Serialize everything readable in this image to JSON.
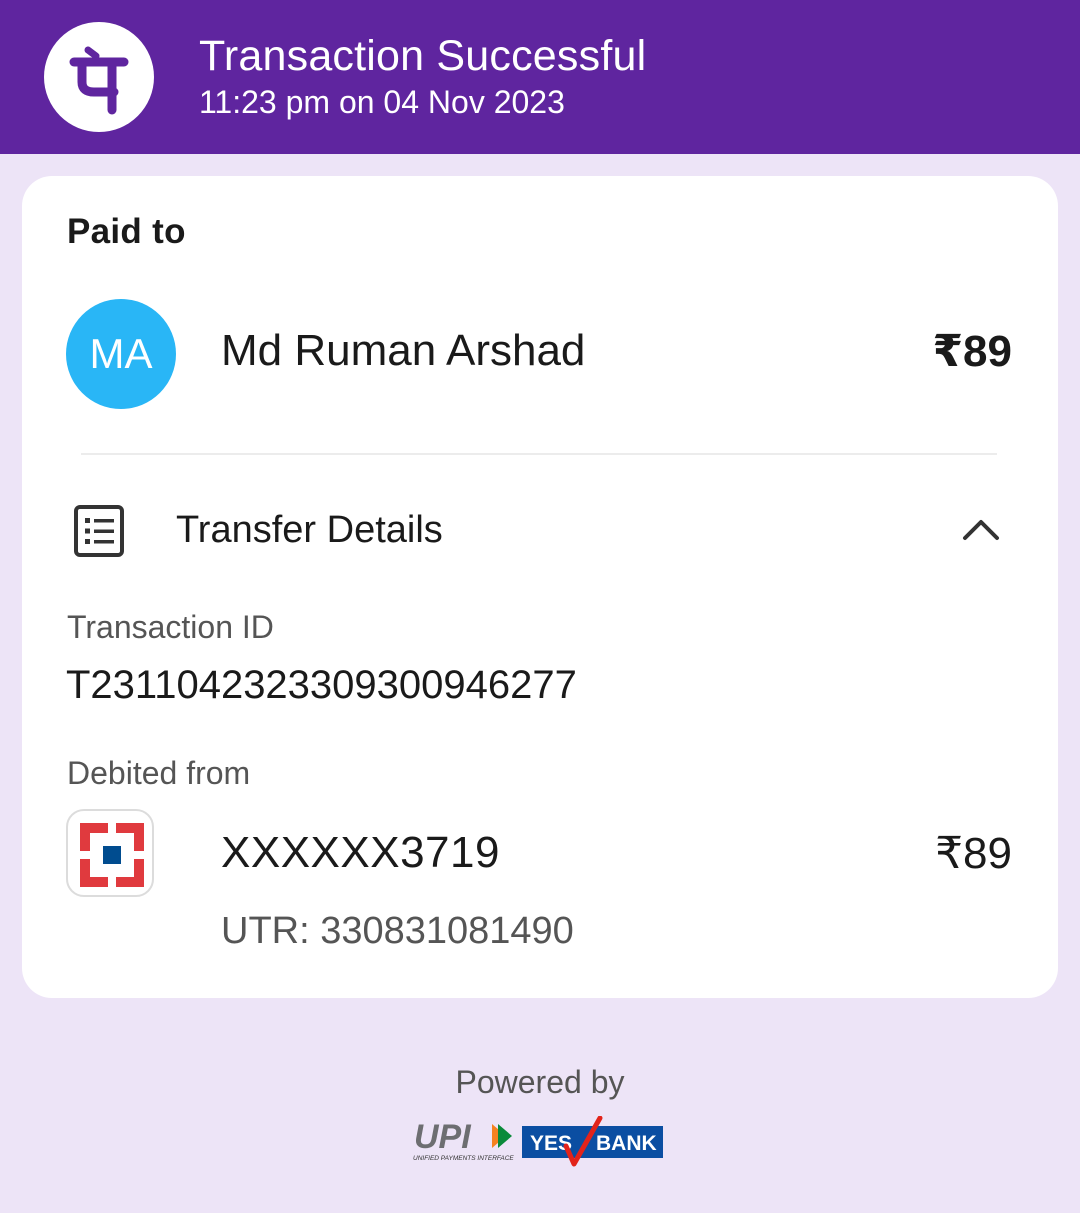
{
  "header": {
    "title": "Transaction Successful",
    "subtitle": "11:23 pm on 04 Nov 2023",
    "brand_color": "#5f259f"
  },
  "paid_to": {
    "label": "Paid to",
    "avatar_initials": "MA",
    "avatar_color": "#29b6f6",
    "name": "Md Ruman Arshad",
    "amount": "₹89"
  },
  "transfer_details": {
    "label": "Transfer Details",
    "icon": "receipt-list-icon",
    "toggle_icon": "chevron-up-icon",
    "transaction_id_label": "Transaction ID",
    "transaction_id": "T2311042323309300946277",
    "debited_from_label": "Debited from",
    "bank_icon": "hdfc-bank-icon",
    "account_number": "XXXXXX3719",
    "account_amount": "₹89",
    "utr": "UTR: 330831081490"
  },
  "footer": {
    "powered_by": "Powered by",
    "upi_text": "UPI",
    "upi_subtext": "UNIFIED PAYMENTS INTERFACE",
    "bank_left": "YES",
    "bank_right": "BANK"
  }
}
